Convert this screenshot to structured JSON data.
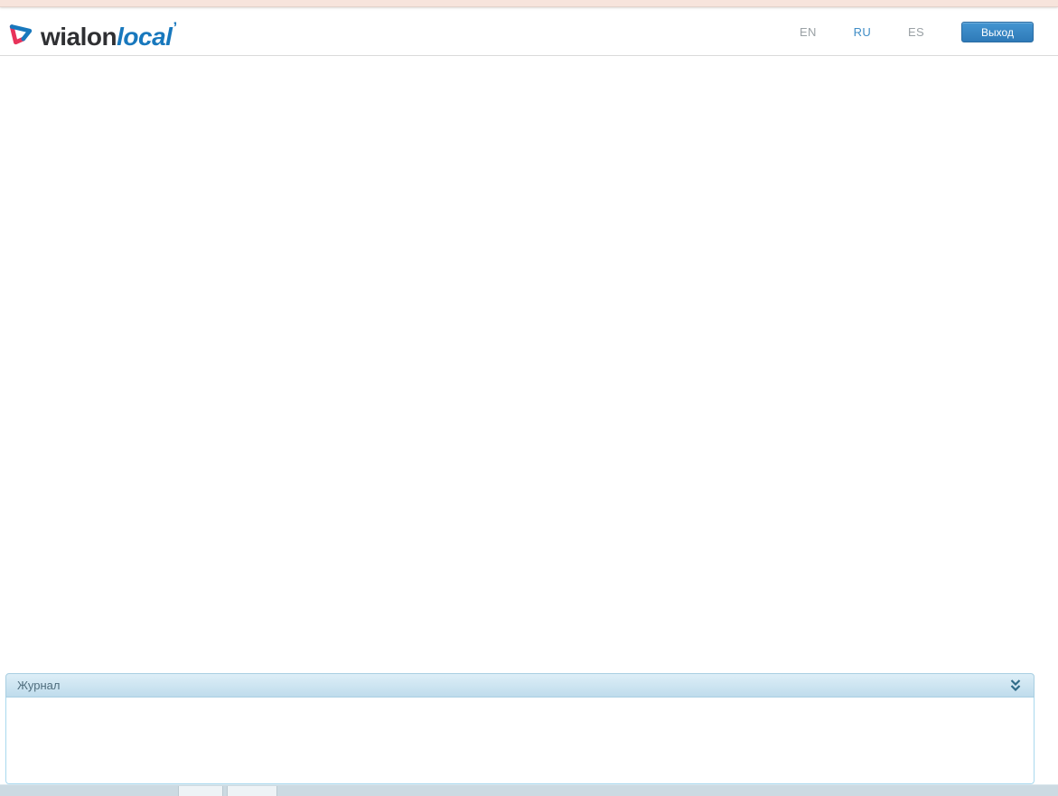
{
  "topbar": {},
  "header": {
    "logo": {
      "text_primary": "wialon",
      "text_secondary": "local",
      "mark": "’"
    },
    "languages": [
      {
        "label": "EN",
        "active": false
      },
      {
        "label": "RU",
        "active": true
      },
      {
        "label": "ES",
        "active": false
      }
    ],
    "logout_label": "Выход"
  },
  "journal": {
    "title": "Журнал",
    "entries": []
  },
  "colors": {
    "topbar_pink": "#f7e4dc",
    "accent_blue": "#3f8dc6",
    "logo_blue": "#1878bd",
    "logo_red": "#e8335a",
    "logo_dark": "#2f3033",
    "button_gradient_top": "#4495d1",
    "button_gradient_bottom": "#2e7ab8",
    "journal_header_top": "#ddeef7",
    "journal_header_bottom": "#bfdcec",
    "journal_border": "#a9d9ee",
    "journal_title_text": "#4f6d7d",
    "chevron": "#2f6b88",
    "bottombar": "#ccdae2",
    "lang_inactive": "#9aa1a5"
  }
}
